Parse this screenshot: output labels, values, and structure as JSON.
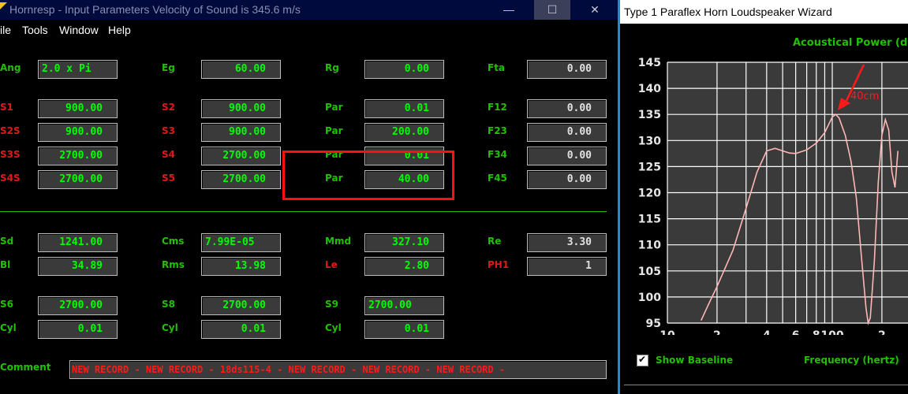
{
  "main_window": {
    "title": "Hornresp - Input Parameters   Velocity of Sound is 345.6 m/s",
    "controls": {
      "minimize": "—",
      "maximize": "☐",
      "close": "✕"
    }
  },
  "menu": [
    "ile",
    "Tools",
    "Window",
    "Help"
  ],
  "params": {
    "ang": {
      "label": "Ang",
      "value": "2.0 x Pi"
    },
    "eg": {
      "label": "Eg",
      "value": "60.00"
    },
    "rg": {
      "label": "Rg",
      "value": "0.00"
    },
    "fta": {
      "label": "Fta",
      "value": "0.00"
    },
    "s1": {
      "label": "S1",
      "value": "900.00"
    },
    "s2": {
      "label": "S2",
      "value": "900.00"
    },
    "par1": {
      "label": "Par",
      "value": "0.01"
    },
    "f12": {
      "label": "F12",
      "value": "0.00"
    },
    "s2s": {
      "label": "S2S",
      "value": "900.00"
    },
    "s3": {
      "label": "S3",
      "value": "900.00"
    },
    "par2": {
      "label": "Par",
      "value": "200.00"
    },
    "f23": {
      "label": "F23",
      "value": "0.00"
    },
    "s3s": {
      "label": "S3S",
      "value": "2700.00"
    },
    "s4": {
      "label": "S4",
      "value": "2700.00"
    },
    "par3": {
      "label": "Par",
      "value": "0.01"
    },
    "f34": {
      "label": "F34",
      "value": "0.00"
    },
    "s4s": {
      "label": "S4S",
      "value": "2700.00"
    },
    "s5": {
      "label": "S5",
      "value": "2700.00"
    },
    "par4": {
      "label": "Par",
      "value": "40.00"
    },
    "f45": {
      "label": "F45",
      "value": "0.00"
    },
    "sd": {
      "label": "Sd",
      "value": "1241.00"
    },
    "cms": {
      "label": "Cms",
      "value": "7.99E-05"
    },
    "mmd": {
      "label": "Mmd",
      "value": "327.10"
    },
    "re": {
      "label": "Re",
      "value": "3.30"
    },
    "bl": {
      "label": "Bl",
      "value": "34.89"
    },
    "rms": {
      "label": "Rms",
      "value": "13.98"
    },
    "le": {
      "label": "Le",
      "value": "2.80"
    },
    "ph1": {
      "label": "PH1",
      "value": "1"
    },
    "s6": {
      "label": "S6",
      "value": "2700.00"
    },
    "s8": {
      "label": "S8",
      "value": "2700.00"
    },
    "s9": {
      "label": "S9",
      "value": "2700.00"
    },
    "cyl1": {
      "label": "Cyl",
      "value": "0.01"
    },
    "cyl2": {
      "label": "Cyl",
      "value": "0.01"
    },
    "cyl3": {
      "label": "Cyl",
      "value": "0.01"
    },
    "comment": {
      "label": "Comment",
      "value": "NEW RECORD - NEW RECORD - 18ds115-4 - NEW RECORD - NEW RECORD - NEW RECORD -"
    }
  },
  "colors": {
    "label_green": "#22c000",
    "label_red": "#e01818",
    "field_text": "#00ff00",
    "highlight": "#ff1010",
    "curve": "#ffb6b6",
    "annotation": "#ff1a1a"
  },
  "wizard": {
    "title": "Type 1 Paraflex Horn Loudspeaker Wizard",
    "show_baseline": {
      "label": "Show Baseline",
      "checked": true,
      "check_glyph": "✔"
    },
    "annotation": "40cm"
  },
  "chart_data": {
    "type": "line",
    "title": "Acoustical Power (dB)",
    "xlabel": "Frequency (hertz)",
    "x_scale": "log",
    "xlim": [
      10,
      250
    ],
    "ylim": [
      95,
      145
    ],
    "yticks": [
      95,
      100,
      105,
      110,
      115,
      120,
      125,
      130,
      135,
      140,
      145
    ],
    "xticks": [
      {
        "value": 10,
        "label": "10"
      },
      {
        "value": 20,
        "label": "2"
      },
      {
        "value": 40,
        "label": "4"
      },
      {
        "value": 60,
        "label": "6"
      },
      {
        "value": 80,
        "label": "8"
      },
      {
        "value": 100,
        "label": "100"
      },
      {
        "value": 200,
        "label": "2"
      }
    ],
    "grid": true,
    "series": [
      {
        "x": [
          16,
          18,
          20,
          25,
          30,
          35,
          40,
          45,
          50,
          55,
          60,
          70,
          80,
          90,
          100,
          105,
          110,
          120,
          130,
          140,
          150,
          160,
          165,
          170,
          180,
          190,
          200,
          210,
          220,
          230,
          240,
          250
        ],
        "y": [
          95.5,
          99,
          102,
          109,
          117,
          124,
          128,
          128.5,
          128,
          127.6,
          127.5,
          128.2,
          129.5,
          131.5,
          134.5,
          135,
          134.3,
          131,
          126,
          119,
          108,
          98,
          95,
          96,
          107,
          122,
          131,
          134,
          132,
          124,
          121,
          128
        ]
      }
    ],
    "annotations": [
      {
        "text": "40cm",
        "x": 105,
        "y": 135
      }
    ]
  }
}
